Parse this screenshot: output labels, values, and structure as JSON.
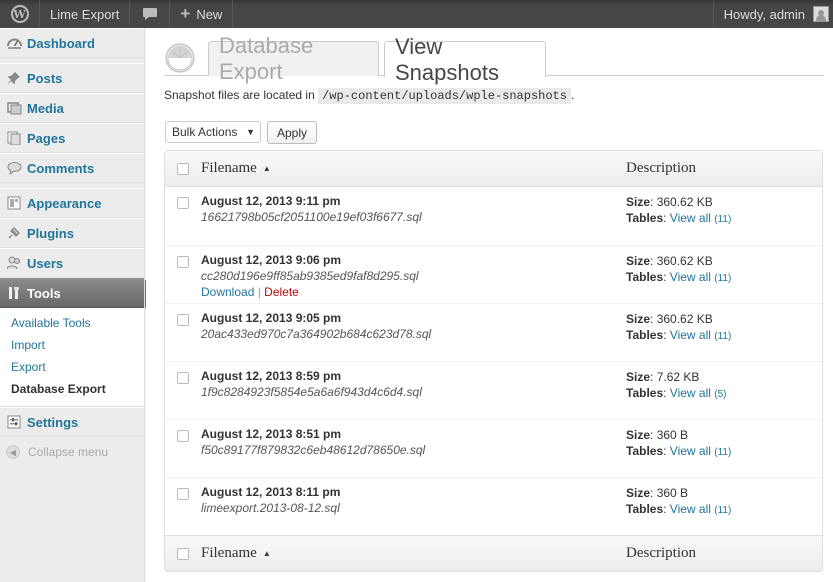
{
  "adminbar": {
    "site_name": "Lime Export",
    "new_label": "New",
    "greeting": "Howdy, admin"
  },
  "sidebar": {
    "items": [
      {
        "label": "Dashboard",
        "icon": "dashboard-icon"
      },
      {
        "label": "Posts",
        "icon": "pin-icon"
      },
      {
        "label": "Media",
        "icon": "media-icon"
      },
      {
        "label": "Pages",
        "icon": "pages-icon"
      },
      {
        "label": "Comments",
        "icon": "comment-icon"
      },
      {
        "label": "Appearance",
        "icon": "appearance-icon"
      },
      {
        "label": "Plugins",
        "icon": "plugin-icon"
      },
      {
        "label": "Users",
        "icon": "users-icon"
      },
      {
        "label": "Tools",
        "icon": "tools-icon"
      },
      {
        "label": "Settings",
        "icon": "settings-icon"
      }
    ],
    "tools_submenu": [
      "Available Tools",
      "Import",
      "Export",
      "Database Export"
    ],
    "collapse_label": "Collapse menu"
  },
  "tabs": {
    "inactive": "Database Export",
    "active": "View Snapshots"
  },
  "description": {
    "prefix": "Snapshot files are located in",
    "path": "/wp-content/uploads/wple-snapshots",
    "suffix": "."
  },
  "bulk": {
    "select_label": "Bulk Actions",
    "apply_label": "Apply"
  },
  "table": {
    "headers": {
      "filename": "Filename",
      "description": "Description"
    },
    "rows": [
      {
        "date": "August 12, 2013 9:11 pm",
        "file": "16621798b05cf2051100e19ef03f6677.sql",
        "size": "360.62 KB",
        "tables_count": "(11)"
      },
      {
        "date": "August 12, 2013 9:06 pm",
        "file": "cc280d196e9ff85ab9385ed9faf8d295.sql",
        "size": "360.62 KB",
        "tables_count": "(11)",
        "download": "Download",
        "delete": "Delete"
      },
      {
        "date": "August 12, 2013 9:05 pm",
        "file": "20ac433ed970c7a364902b684c623d78.sql",
        "size": "360.62 KB",
        "tables_count": "(11)"
      },
      {
        "date": "August 12, 2013 8:59 pm",
        "file": "1f9c8284923f5854e5a6a6f943d4c6d4.sql",
        "size": "7.62 KB",
        "tables_count": "(5)"
      },
      {
        "date": "August 12, 2013 8:51 pm",
        "file": "f50c89177f879832c6eb48612d78650e.sql",
        "size": "360 B",
        "tables_count": "(11)"
      },
      {
        "date": "August 12, 2013 8:11 pm",
        "file": "limeexport.2013-08-12.sql",
        "size": "360 B",
        "tables_count": "(11)"
      }
    ],
    "size_label": "Size",
    "tables_label": "Tables",
    "view_all": "View all"
  }
}
